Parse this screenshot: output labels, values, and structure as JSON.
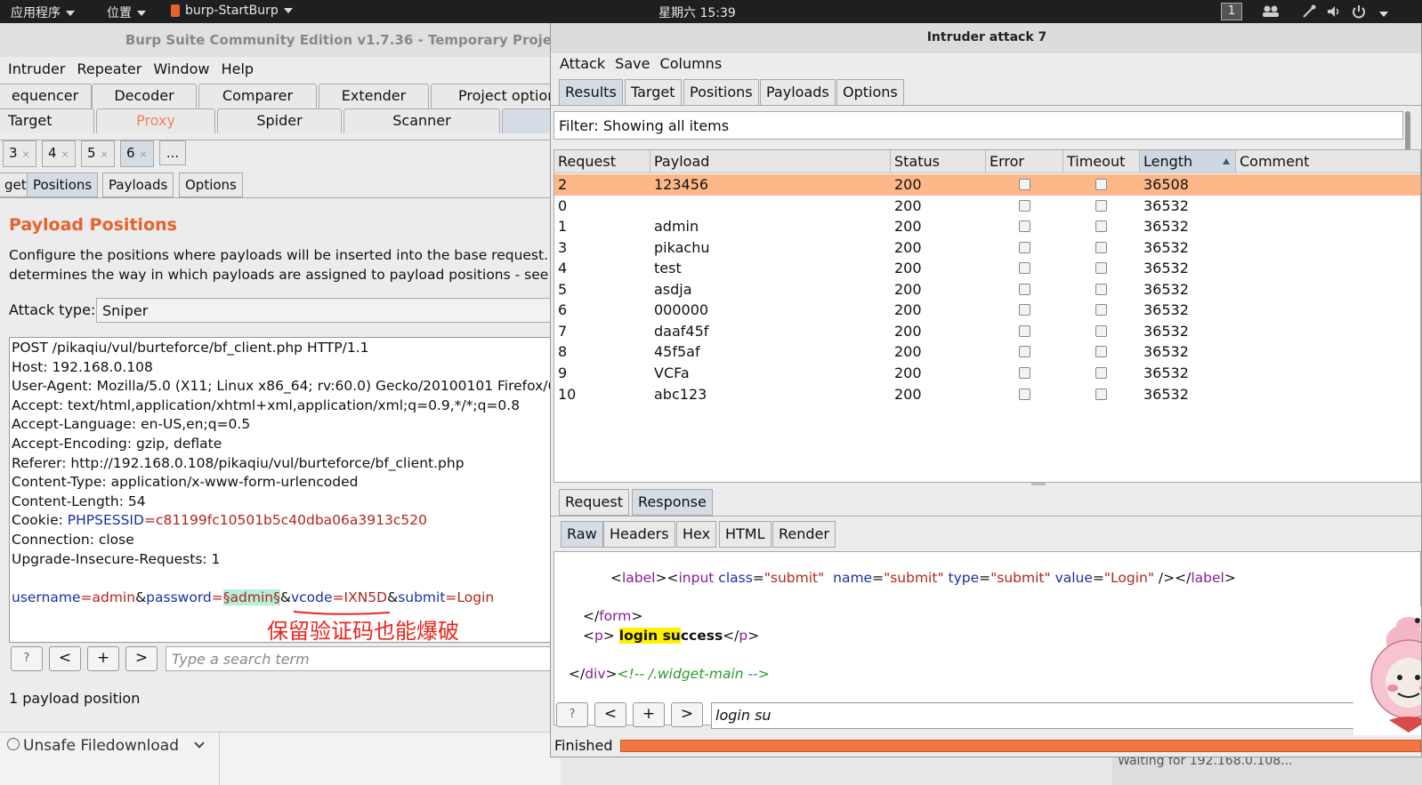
{
  "topbar": {
    "apps": "应用程序",
    "places": "位置",
    "active_app": "burp-StartBurp",
    "clock": "星期六 15:39",
    "workspace": "1"
  },
  "left_window": {
    "title": "Burp Suite Community Edition v1.7.36 - Temporary Proje",
    "menu": [
      "Intruder",
      "Repeater",
      "Window",
      "Help"
    ],
    "tabs_row1": [
      "equencer",
      "Decoder",
      "Comparer",
      "Extender",
      "Project option"
    ],
    "tabs_row2": [
      "Target",
      "Proxy",
      "Spider",
      "Scanner"
    ],
    "request_tabs": [
      "3",
      "4",
      "5",
      "6",
      "..."
    ],
    "sub_tabs": [
      "get",
      "Positions",
      "Payloads",
      "Options"
    ],
    "section_title": "Payload Positions",
    "description_line1": "Configure the positions where payloads will be inserted into the base request. The",
    "description_line2": "determines the way in which payloads are assigned to payload positions - see help",
    "attack_type_label": "Attack type:",
    "attack_type_value": "Sniper",
    "request_lines": [
      "POST /pikaqiu/vul/burteforce/bf_client.php HTTP/1.1",
      "Host: 192.168.0.108",
      "User-Agent: Mozilla/5.0 (X11; Linux x86_64; rv:60.0) Gecko/20100101 Firefox/6",
      "Accept: text/html,application/xhtml+xml,application/xml;q=0.9,*/*;q=0.8",
      "Accept-Language: en-US,en;q=0.5",
      "Accept-Encoding: gzip, deflate",
      "Referer: http://192.168.0.108/pikaqiu/vul/burteforce/bf_client.php",
      "Content-Type: application/x-www-form-urlencoded",
      "Content-Length: 54"
    ],
    "cookie_label": "Cookie: ",
    "cookie_name": "PHPSESSID",
    "cookie_eq": "=",
    "cookie_value": "c81199fc10501b5c40dba06a3913c520",
    "request_lines_2": [
      "Connection: close",
      "Upgrade-Insecure-Requests: 1"
    ],
    "body": {
      "username_key": "username",
      "username_val": "admin",
      "password_key": "password",
      "password_val": "§admin§",
      "vcode_key": "vcode",
      "vcode_val": "IXN5D",
      "submit_key": "submit",
      "submit_val": "Login"
    },
    "annotation": "保留验证码也能爆破",
    "search_placeholder": "Type a search term",
    "payload_count": "1 payload position",
    "bottom_button": "Unsafe Filedownload",
    "status_right": "Waiting for 192.168.0.108..."
  },
  "attack_window": {
    "title": "Intruder attack 7",
    "menu": [
      "Attack",
      "Save",
      "Columns"
    ],
    "tabs": [
      "Results",
      "Target",
      "Positions",
      "Payloads",
      "Options"
    ],
    "filter": "Filter: Showing all items",
    "columns": [
      "Request",
      "Payload",
      "Status",
      "Error",
      "Timeout",
      "Length",
      "Comment"
    ],
    "rows": [
      {
        "request": "2",
        "payload": "123456",
        "status": "200",
        "length": "36508"
      },
      {
        "request": "0",
        "payload": "",
        "status": "200",
        "length": "36532"
      },
      {
        "request": "1",
        "payload": "admin",
        "status": "200",
        "length": "36532"
      },
      {
        "request": "3",
        "payload": "pikachu",
        "status": "200",
        "length": "36532"
      },
      {
        "request": "4",
        "payload": "test",
        "status": "200",
        "length": "36532"
      },
      {
        "request": "5",
        "payload": "asdja",
        "status": "200",
        "length": "36532"
      },
      {
        "request": "6",
        "payload": "000000",
        "status": "200",
        "length": "36532"
      },
      {
        "request": "7",
        "payload": "daaf45f",
        "status": "200",
        "length": "36532"
      },
      {
        "request": "8",
        "payload": "45f5af",
        "status": "200",
        "length": "36532"
      },
      {
        "request": "9",
        "payload": "VCFa",
        "status": "200",
        "length": "36532"
      },
      {
        "request": "10",
        "payload": "abc123",
        "status": "200",
        "length": "36532"
      }
    ],
    "detail_tabs": [
      "Request",
      "Response"
    ],
    "view_tabs": [
      "Raw",
      "Headers",
      "Hex",
      "HTML",
      "Render"
    ],
    "search_value": "login su",
    "status": "Finished",
    "colors": {
      "selected_row": "#fdb88a",
      "progress": "#f1763f",
      "accent_orange": "#e8622c"
    }
  }
}
